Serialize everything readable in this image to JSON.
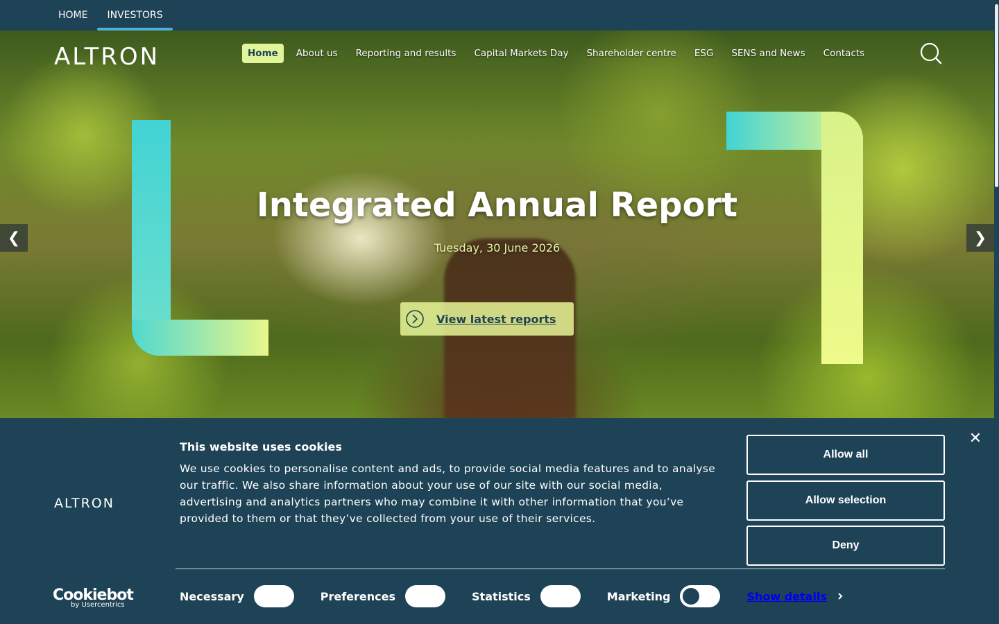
{
  "topnav": {
    "home_label": "HOME",
    "investors_label": "INVESTORS"
  },
  "header": {
    "logo_text": "ALTRON",
    "menu": [
      {
        "label": "Home",
        "active": true
      },
      {
        "label": "About us"
      },
      {
        "label": "Reporting and results"
      },
      {
        "label": "Capital Markets Day"
      },
      {
        "label": "Shareholder centre"
      },
      {
        "label": "ESG"
      },
      {
        "label": "SENS and News"
      },
      {
        "label": "Contacts"
      }
    ],
    "search_icon": "search-icon"
  },
  "hero": {
    "title": "Integrated Annual Report",
    "date": "Tuesday, 30 June 2026",
    "cta_label": "View latest reports",
    "prev_glyph": "❮",
    "next_glyph": "❯",
    "accent_colors": [
      "#42d3d4",
      "#e9f78a"
    ]
  },
  "cookie_banner": {
    "logo_text": "ALTRON",
    "title": "This website uses cookies",
    "text": "We use cookies to personalise content and ads, to provide social media features and to analyse our traffic. We also share information about your use of our site with our social media, advertising and analytics partners who may combine it with other information that you’ve provided to them or that they’ve collected from your use of their services.",
    "close_glyph": "✕",
    "buttons": {
      "allow_all": "Allow all",
      "allow_selection": "Allow selection",
      "deny": "Deny"
    },
    "toggles": [
      {
        "label": "Necessary",
        "on": true
      },
      {
        "label": "Preferences",
        "on": true
      },
      {
        "label": "Statistics",
        "on": true
      },
      {
        "label": "Marketing",
        "on": false
      }
    ],
    "show_details": "Show details",
    "cookiebot_brand": "Cookiebot",
    "cookiebot_sub": "by Usercentrics"
  },
  "colors": {
    "primary": "#1e4256",
    "accent_blue": "#4fb0dc",
    "accent_lime": "#e3f59a"
  }
}
